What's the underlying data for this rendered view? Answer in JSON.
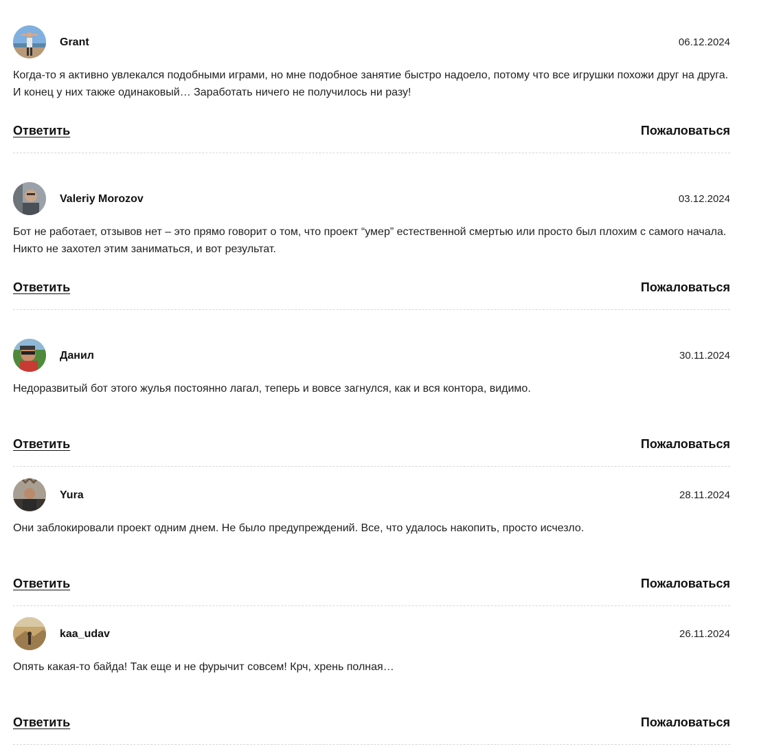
{
  "comments": [
    {
      "author": "Grant",
      "date": "06.12.2024",
      "text": "Когда-то я активно увлекался подобными играми, но мне подобное занятие быстро надоело, потому что все игрушки похожи друг на друга. И конец у них также одинаковый… Заработать ничего не получилось ни разу!",
      "reply_label": "Ответить",
      "report_label": "Пожаловаться"
    },
    {
      "author": "Valeriy Morozov",
      "date": "03.12.2024",
      "text": "Бот не работает, отзывов нет – это прямо говорит о том, что проект “умер” естественной смертью или просто был плохим с самого начала. Никто не захотел этим заниматься, и вот результат.",
      "reply_label": "Ответить",
      "report_label": "Пожаловаться"
    },
    {
      "author": "Данил",
      "date": "30.11.2024",
      "text": "Недоразвитый бот этого жулья постоянно лагал, теперь и вовсе загнулся, как и вся контора, видимо.",
      "reply_label": "Ответить",
      "report_label": "Пожаловаться"
    },
    {
      "author": "Yura",
      "date": "28.11.2024",
      "text": "Они заблокировали проект одним днем. Не было предупреждений. Все, что удалось накопить, просто исчезло.",
      "reply_label": "Ответить",
      "report_label": "Пожаловаться"
    },
    {
      "author": "kaa_udav",
      "date": "26.11.2024",
      "text": "Опять какая-то байда! Так еще и не фурычит совсем! Крч, хрень полная…",
      "reply_label": "Ответить",
      "report_label": "Пожаловаться"
    }
  ]
}
